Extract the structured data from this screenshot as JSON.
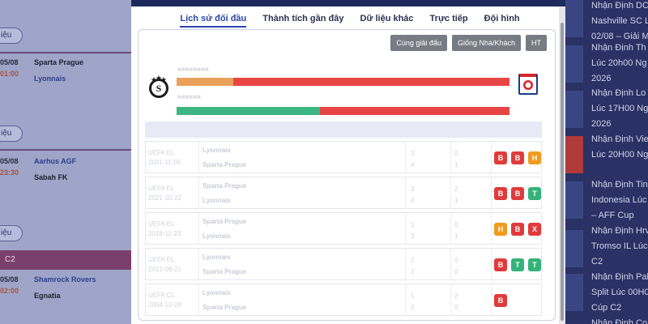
{
  "background": {
    "left_matches": [
      {
        "pill": "iệu",
        "date": "05/08",
        "time": "01:00",
        "home": "Sparta Prague",
        "away": "Lyonnais"
      },
      {
        "pill": "iệu",
        "date": "05/08",
        "time": "23:30",
        "home": "Aarhus AGF",
        "away": "Sabah FK"
      },
      {
        "pill": "iệu",
        "league": "C2",
        "date": "05/08",
        "time": "02:00",
        "home": "Shamrock Rovers",
        "away": "Egnatia"
      }
    ],
    "news": [
      [
        "Nhận Định DC",
        "Nashville SC L",
        "02/08 – Giải M"
      ],
      [
        "Nhận Định Th",
        "Lúc 20h00 Ng",
        "2026"
      ],
      [
        "Nhận Định Lo",
        "Lúc 17H00 Ng",
        "2026"
      ],
      [
        "Nhận Định Vie",
        "Lúc 20H00 Ng"
      ],
      [
        "Nhận Định Tin",
        "Indonesia Lúc",
        "– AFF Cup"
      ],
      [
        "Nhận Định Hrv",
        "Tromso IL Lúc",
        "C2"
      ],
      [
        "Nhận Định Pal",
        "Split Lúc 00H0",
        "Cúp C2"
      ],
      [
        "Nhận Định Co"
      ]
    ]
  },
  "modal": {
    "tabs": [
      "Lịch sử đối đầu",
      "Thành tích gần đây",
      "Dữ liệu khác",
      "Trực tiếp",
      "Đội hình"
    ],
    "active_tab": 0,
    "filters": [
      "Cùng giải đấu",
      "Giống Nhà/Khách",
      "HT"
    ],
    "crests": {
      "home": "Sparta Prague crest",
      "away": "Olympique Lyonnais crest"
    },
    "bar1": {
      "home_share": 0.17,
      "colors": [
        "#e8a05a",
        "#e84545"
      ]
    },
    "bar2": {
      "home_share": 0.43,
      "colors": [
        "#3cb784",
        "#e84545"
      ]
    },
    "rows": [
      {
        "league": "UEFA EL",
        "date": "2021-11-05",
        "home": "Lyonnais",
        "away": "Sparta Prague",
        "s1": "3",
        "s2": "4",
        "h1": "0",
        "h2": "1",
        "badges": [
          [
            "B",
            "#e03b3b"
          ],
          [
            "B",
            "#e03b3b"
          ],
          [
            "H",
            "#f29a1d"
          ]
        ]
      },
      {
        "league": "UEFA EL",
        "date": "2021-10-22",
        "home": "Sparta Prague",
        "away": "Lyonnais",
        "s1": "3",
        "s2": "4",
        "h1": "2",
        "h2": "1",
        "badges": [
          [
            "B",
            "#e03b3b"
          ],
          [
            "B",
            "#e03b3b"
          ],
          [
            "T",
            "#34b27a"
          ]
        ]
      },
      {
        "league": "UEFA EL",
        "date": "2018-11-23",
        "home": "Sparta Prague",
        "away": "Lyonnais",
        "s1": "1",
        "s2": "3",
        "h1": "0",
        "h2": "1",
        "badges": [
          [
            "H",
            "#f29a1d"
          ],
          [
            "B",
            "#e03b3b"
          ],
          [
            "X",
            "#e03b3b"
          ]
        ]
      },
      {
        "league": "UEFA EL",
        "date": "2012-09-21",
        "home": "Lyonnais",
        "away": "Sparta Prague",
        "s1": "2",
        "s2": "1",
        "h1": "0",
        "h2": "0",
        "badges": [
          [
            "B",
            "#e03b3b"
          ],
          [
            "T",
            "#34b27a"
          ],
          [
            "T",
            "#34b27a"
          ]
        ]
      },
      {
        "league": "UEFA CL",
        "date": "2004-12-09",
        "home": "Lyonnais",
        "away": "Sparta Prague",
        "s1": "5",
        "s2": "0",
        "h1": "2",
        "h2": "0",
        "badges": [
          [
            "B",
            "#e03b3b"
          ]
        ]
      }
    ]
  }
}
